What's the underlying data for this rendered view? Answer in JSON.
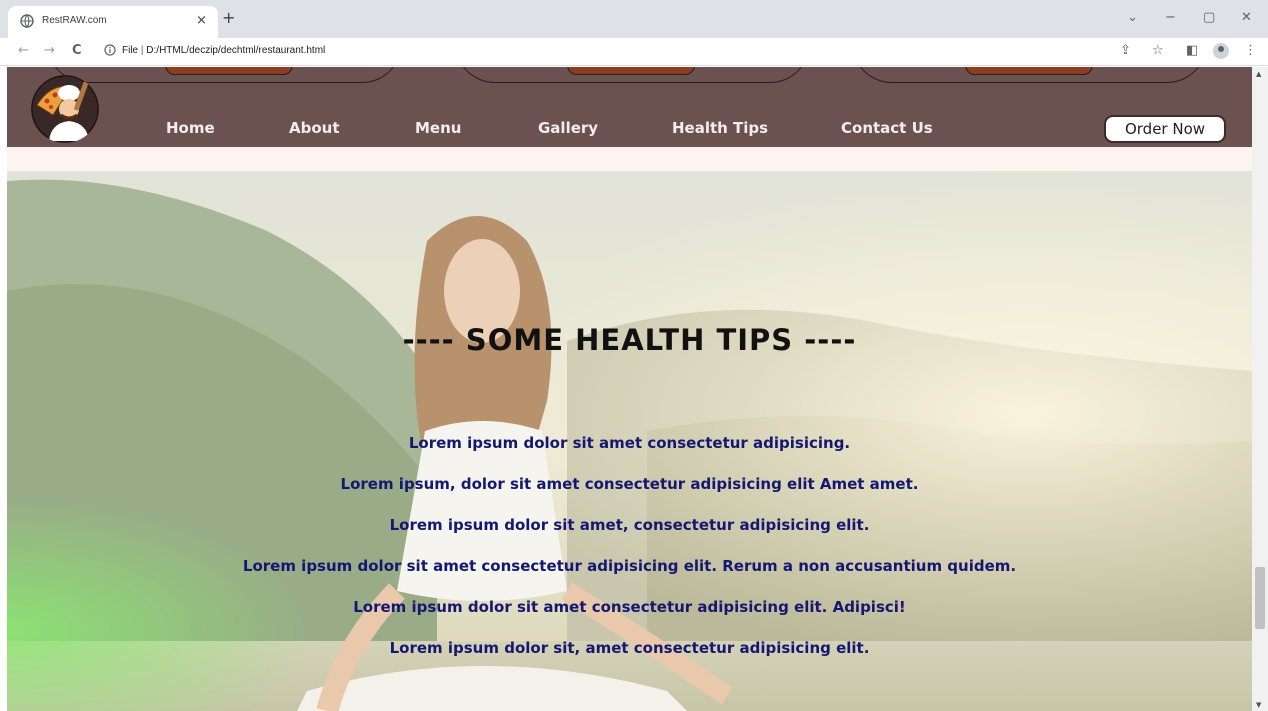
{
  "browser": {
    "tab_title": "RestRAW.com",
    "tab_close": "×",
    "new_tab": "+",
    "window_controls": [
      "⌄",
      "−",
      "▢",
      "✕"
    ],
    "nav": [
      "←",
      "→",
      "C"
    ],
    "url_prefix": "File",
    "url_separator": "|",
    "url": "D:/HTML/deczip/dechtml/restaurant.html",
    "address_icons": [
      "⇪",
      "☆",
      "◧",
      "⋮"
    ]
  },
  "navbar": {
    "links": [
      "Home",
      "About",
      "Menu",
      "Gallery",
      "Health Tips",
      "Contact Us"
    ],
    "order_button": "Order Now",
    "color": "#6b5251"
  },
  "hero": {
    "heading": "---- SOME HEALTH TIPS ----",
    "tips": [
      "Lorem ipsum dolor sit amet consectetur adipisicing.",
      "Lorem ipsum, dolor sit amet consectetur adipisicing elit Amet amet.",
      "Lorem ipsum dolor sit amet, consectetur adipisicing elit.",
      "Lorem ipsum dolor sit amet consectetur adipisicing elit. Rerum a non accusantium quidem.",
      "Lorem ipsum dolor sit amet consectetur adipisicing elit. Adipisci!",
      "Lorem ipsum dolor sit, amet consectetur adipisicing elit."
    ],
    "tip_color": "#141870"
  }
}
